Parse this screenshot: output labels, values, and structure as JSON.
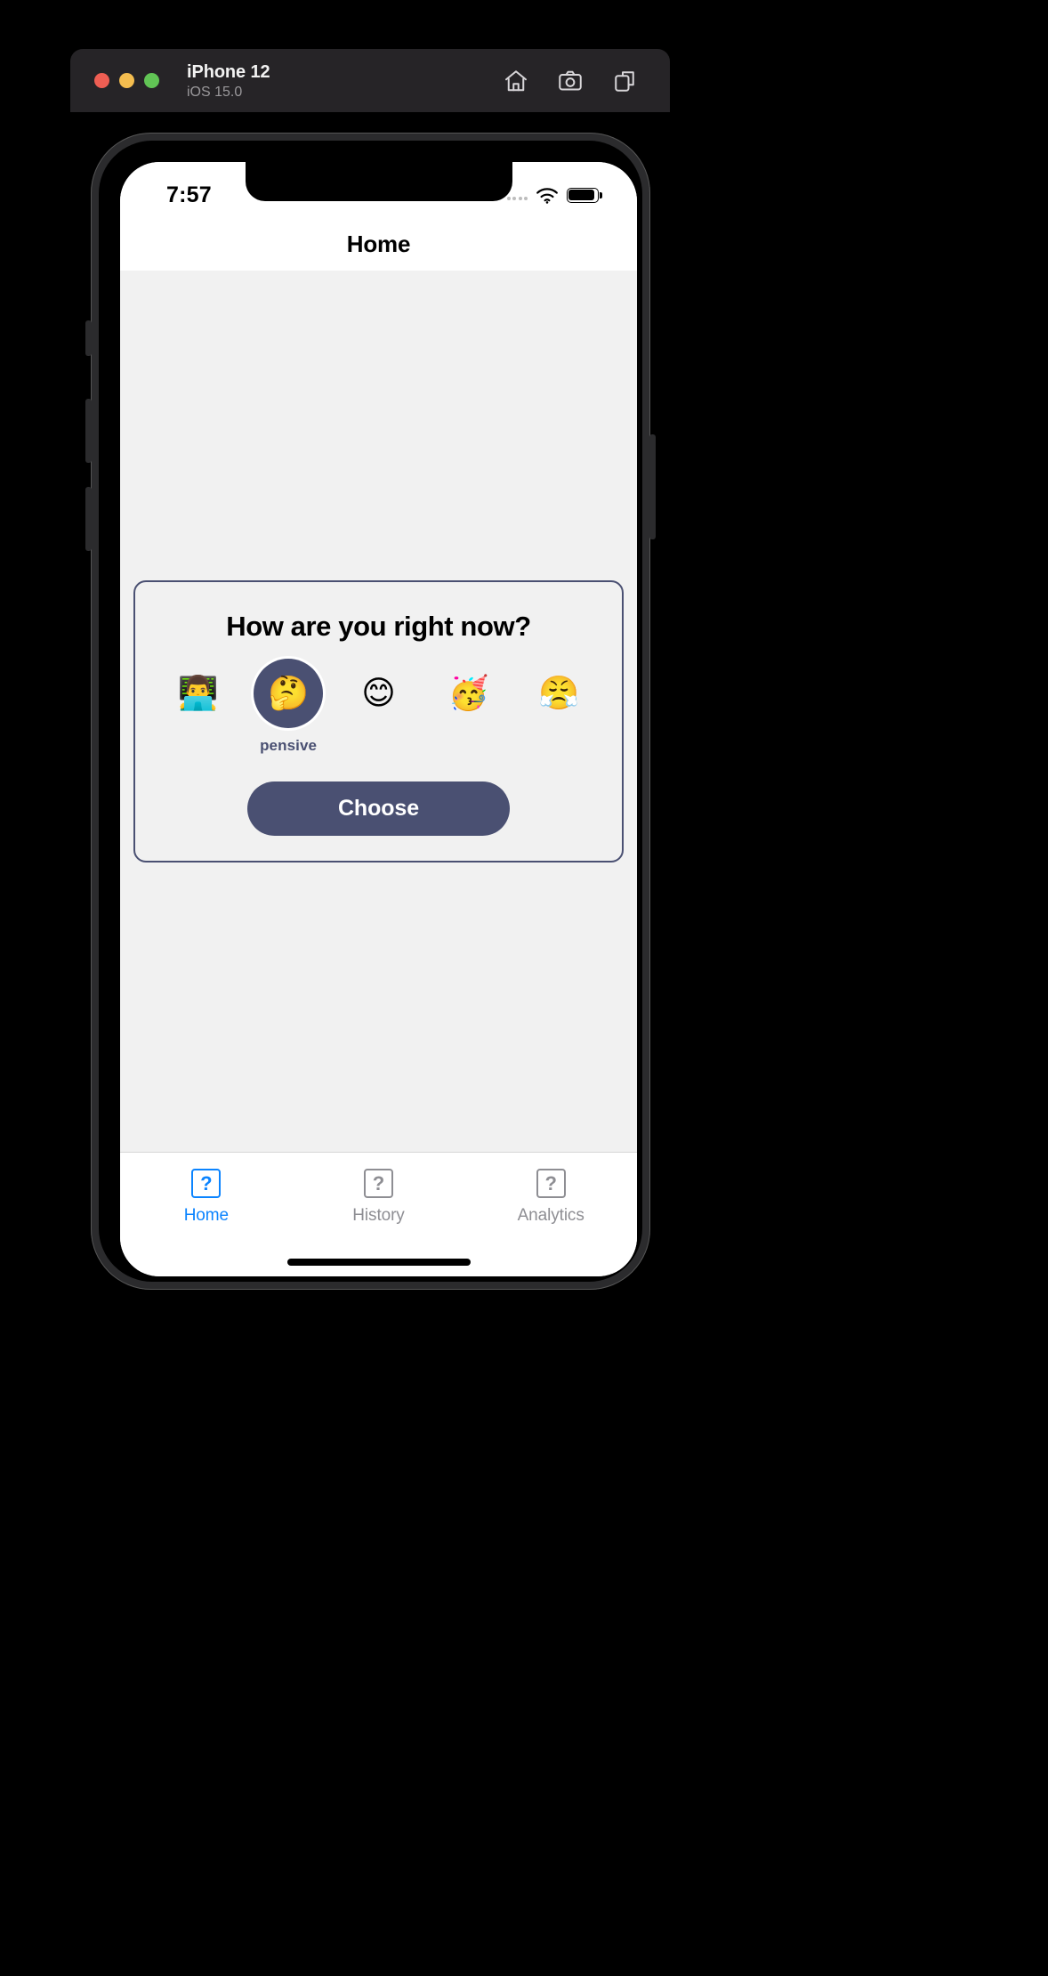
{
  "simulator_window": {
    "title": "iPhone 12",
    "subtitle": "iOS 15.0",
    "traffic_lights": [
      {
        "name": "close",
        "color": "#EE5E53"
      },
      {
        "name": "minimize",
        "color": "#F4BD4F"
      },
      {
        "name": "zoom",
        "color": "#61C455"
      }
    ],
    "toolbar_icons": [
      {
        "name": "home-icon",
        "label": "Home"
      },
      {
        "name": "screenshot-icon",
        "label": "Screenshot"
      },
      {
        "name": "rotate-icon",
        "label": "Rotate"
      }
    ],
    "titlebar_color": "#262427"
  },
  "status_bar": {
    "time": "7:57",
    "signal_icon": "signal-dots-icon",
    "wifi_icon": "wifi-icon",
    "battery_icon": "battery-full-icon"
  },
  "nav_bar": {
    "title": "Home"
  },
  "card": {
    "question": "How are you right now?",
    "border_color": "#4A5072",
    "background": "#F1F1F1",
    "moods": [
      {
        "emoji": "👨‍💻",
        "icon_name": "person-at-laptop-emoji",
        "label": "",
        "selected": false
      },
      {
        "emoji": "🤔",
        "icon_name": "thinking-face-emoji",
        "label": "pensive",
        "selected": true
      },
      {
        "emoji": "😊",
        "icon_name": "smiling-face-emoji",
        "label": "",
        "selected": false
      },
      {
        "emoji": "🥳",
        "icon_name": "partying-face-emoji",
        "label": "",
        "selected": false
      },
      {
        "emoji": "😤",
        "icon_name": "face-with-steam-emoji",
        "label": "",
        "selected": false
      }
    ],
    "choose_button": "Choose",
    "accent_color": "#4A5072"
  },
  "tab_bar": {
    "active_color": "#0B84FF",
    "inactive_color": "#8E8E93",
    "tabs": [
      {
        "label": "Home",
        "icon": "?",
        "icon_name": "missing-image-icon",
        "active": true
      },
      {
        "label": "History",
        "icon": "?",
        "icon_name": "missing-image-icon",
        "active": false
      },
      {
        "label": "Analytics",
        "icon": "?",
        "icon_name": "missing-image-icon",
        "active": false
      }
    ]
  }
}
